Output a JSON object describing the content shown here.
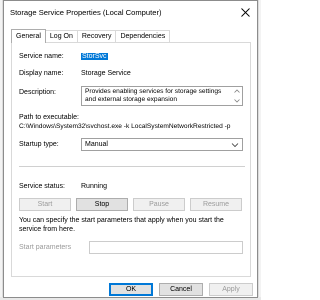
{
  "window": {
    "title": "Storage Service Properties (Local Computer)",
    "close_icon": "close-icon"
  },
  "tabs": [
    {
      "label": "General",
      "active": true
    },
    {
      "label": "Log On",
      "active": false
    },
    {
      "label": "Recovery",
      "active": false
    },
    {
      "label": "Dependencies",
      "active": false
    }
  ],
  "general": {
    "service_name_label": "Service name:",
    "service_name_value": "StorSvc",
    "display_name_label": "Display name:",
    "display_name_value": "Storage Service",
    "description_label": "Description:",
    "description_value": "Provides enabling services for storage settings and external storage expansion",
    "path_label": "Path to executable:",
    "path_value": "C:\\Windows\\System32\\svchost.exe -k LocalSystemNetworkRestricted -p",
    "startup_type_label": "Startup type:",
    "startup_type_value": "Manual",
    "service_status_label": "Service status:",
    "service_status_value": "Running",
    "buttons": {
      "start": "Start",
      "stop": "Stop",
      "pause": "Pause",
      "resume": "Resume"
    },
    "info_text": "You can specify the start parameters that apply when you start the service from here.",
    "start_parameters_label": "Start parameters",
    "start_parameters_value": ""
  },
  "footer": {
    "ok": "OK",
    "cancel": "Cancel",
    "apply": "Apply"
  },
  "colors": {
    "accent": "#0078d7",
    "disabled_text": "#9a9a9a",
    "button_face": "#e1e1e1"
  }
}
